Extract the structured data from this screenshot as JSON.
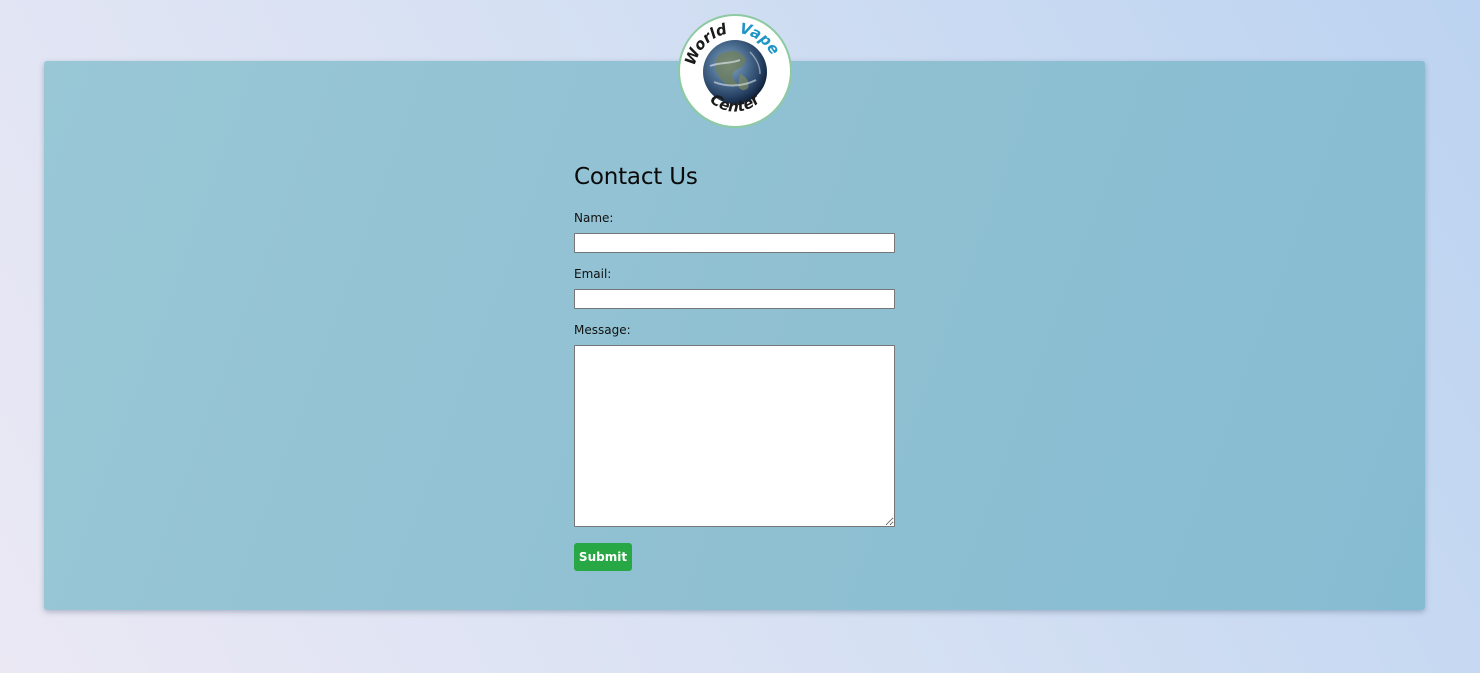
{
  "logo": {
    "top_text_left": "World",
    "top_text_right": "Vape",
    "bottom_text": "Center"
  },
  "form": {
    "title": "Contact Us",
    "name_label": "Name:",
    "name_value": "",
    "email_label": "Email:",
    "email_value": "",
    "message_label": "Message:",
    "message_value": "",
    "submit_label": "Submit"
  },
  "colors": {
    "submit_button": "#28a745",
    "card_background": "#8fc0d2",
    "logo_accent": "#1f95c4"
  },
  "icons": {
    "logo": "earth-globe-icon",
    "textarea_resize": "resize-handle-icon"
  }
}
